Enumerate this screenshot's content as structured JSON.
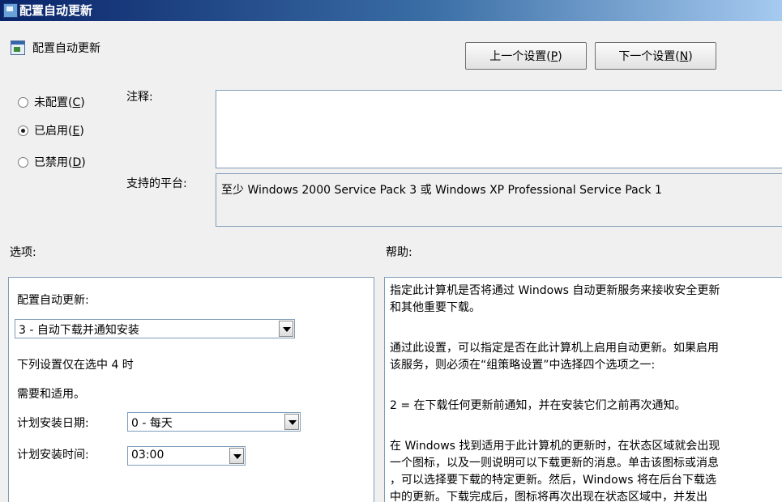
{
  "window": {
    "title": "配置自动更新"
  },
  "header": {
    "title": "配置自动更新",
    "icon": "policy-icon"
  },
  "nav": {
    "prev_label": "上一个设置(P)",
    "next_label": "下一个设置(N)"
  },
  "state": {
    "options": [
      {
        "label": "未配置(C)",
        "checked": false
      },
      {
        "label": "已启用(E)",
        "checked": true
      },
      {
        "label": "已禁用(D)",
        "checked": false
      }
    ]
  },
  "comment": {
    "label": "注释:",
    "value": ""
  },
  "platform": {
    "label": "支持的平台:",
    "value": "至少 Windows 2000 Service Pack 3 或 Windows XP Professional Service Pack 1"
  },
  "sections": {
    "options_label": "选项:",
    "help_label": "帮助:"
  },
  "options_panel": {
    "config_label": "配置自动更新:",
    "config_value": "3 - 自动下载并通知安装",
    "note_line1": "下列设置仅在选中 4 时",
    "note_line2": "需要和适用。",
    "day_label": "计划安装日期:",
    "day_value": "0 - 每天",
    "time_label": "计划安装时间:",
    "time_value": "03:00"
  },
  "help": {
    "lines": [
      "指定此计算机是否将通过 Windows 自动更新服务来接收安全更新",
      "和其他重要下载。",
      "通过此设置，可以指定是否在此计算机上启用自动更新。如果启用",
      "该服务，则必须在“组策略设置”中选择四个选项之一:",
      "2 = 在下载任何更新前通知，并在安装它们之前再次通知。",
      "在 Windows 找到适用于此计算机的更新时，在状态区域就会出现",
      "一个图标，以及一则说明可以下载更新的消息。单击该图标或消息",
      "，可以选择要下载的特定更新。然后，Windows 将在后台下载选",
      "中的更新。下载完成后，图标将再次出现在状态区域中，并发出"
    ]
  }
}
